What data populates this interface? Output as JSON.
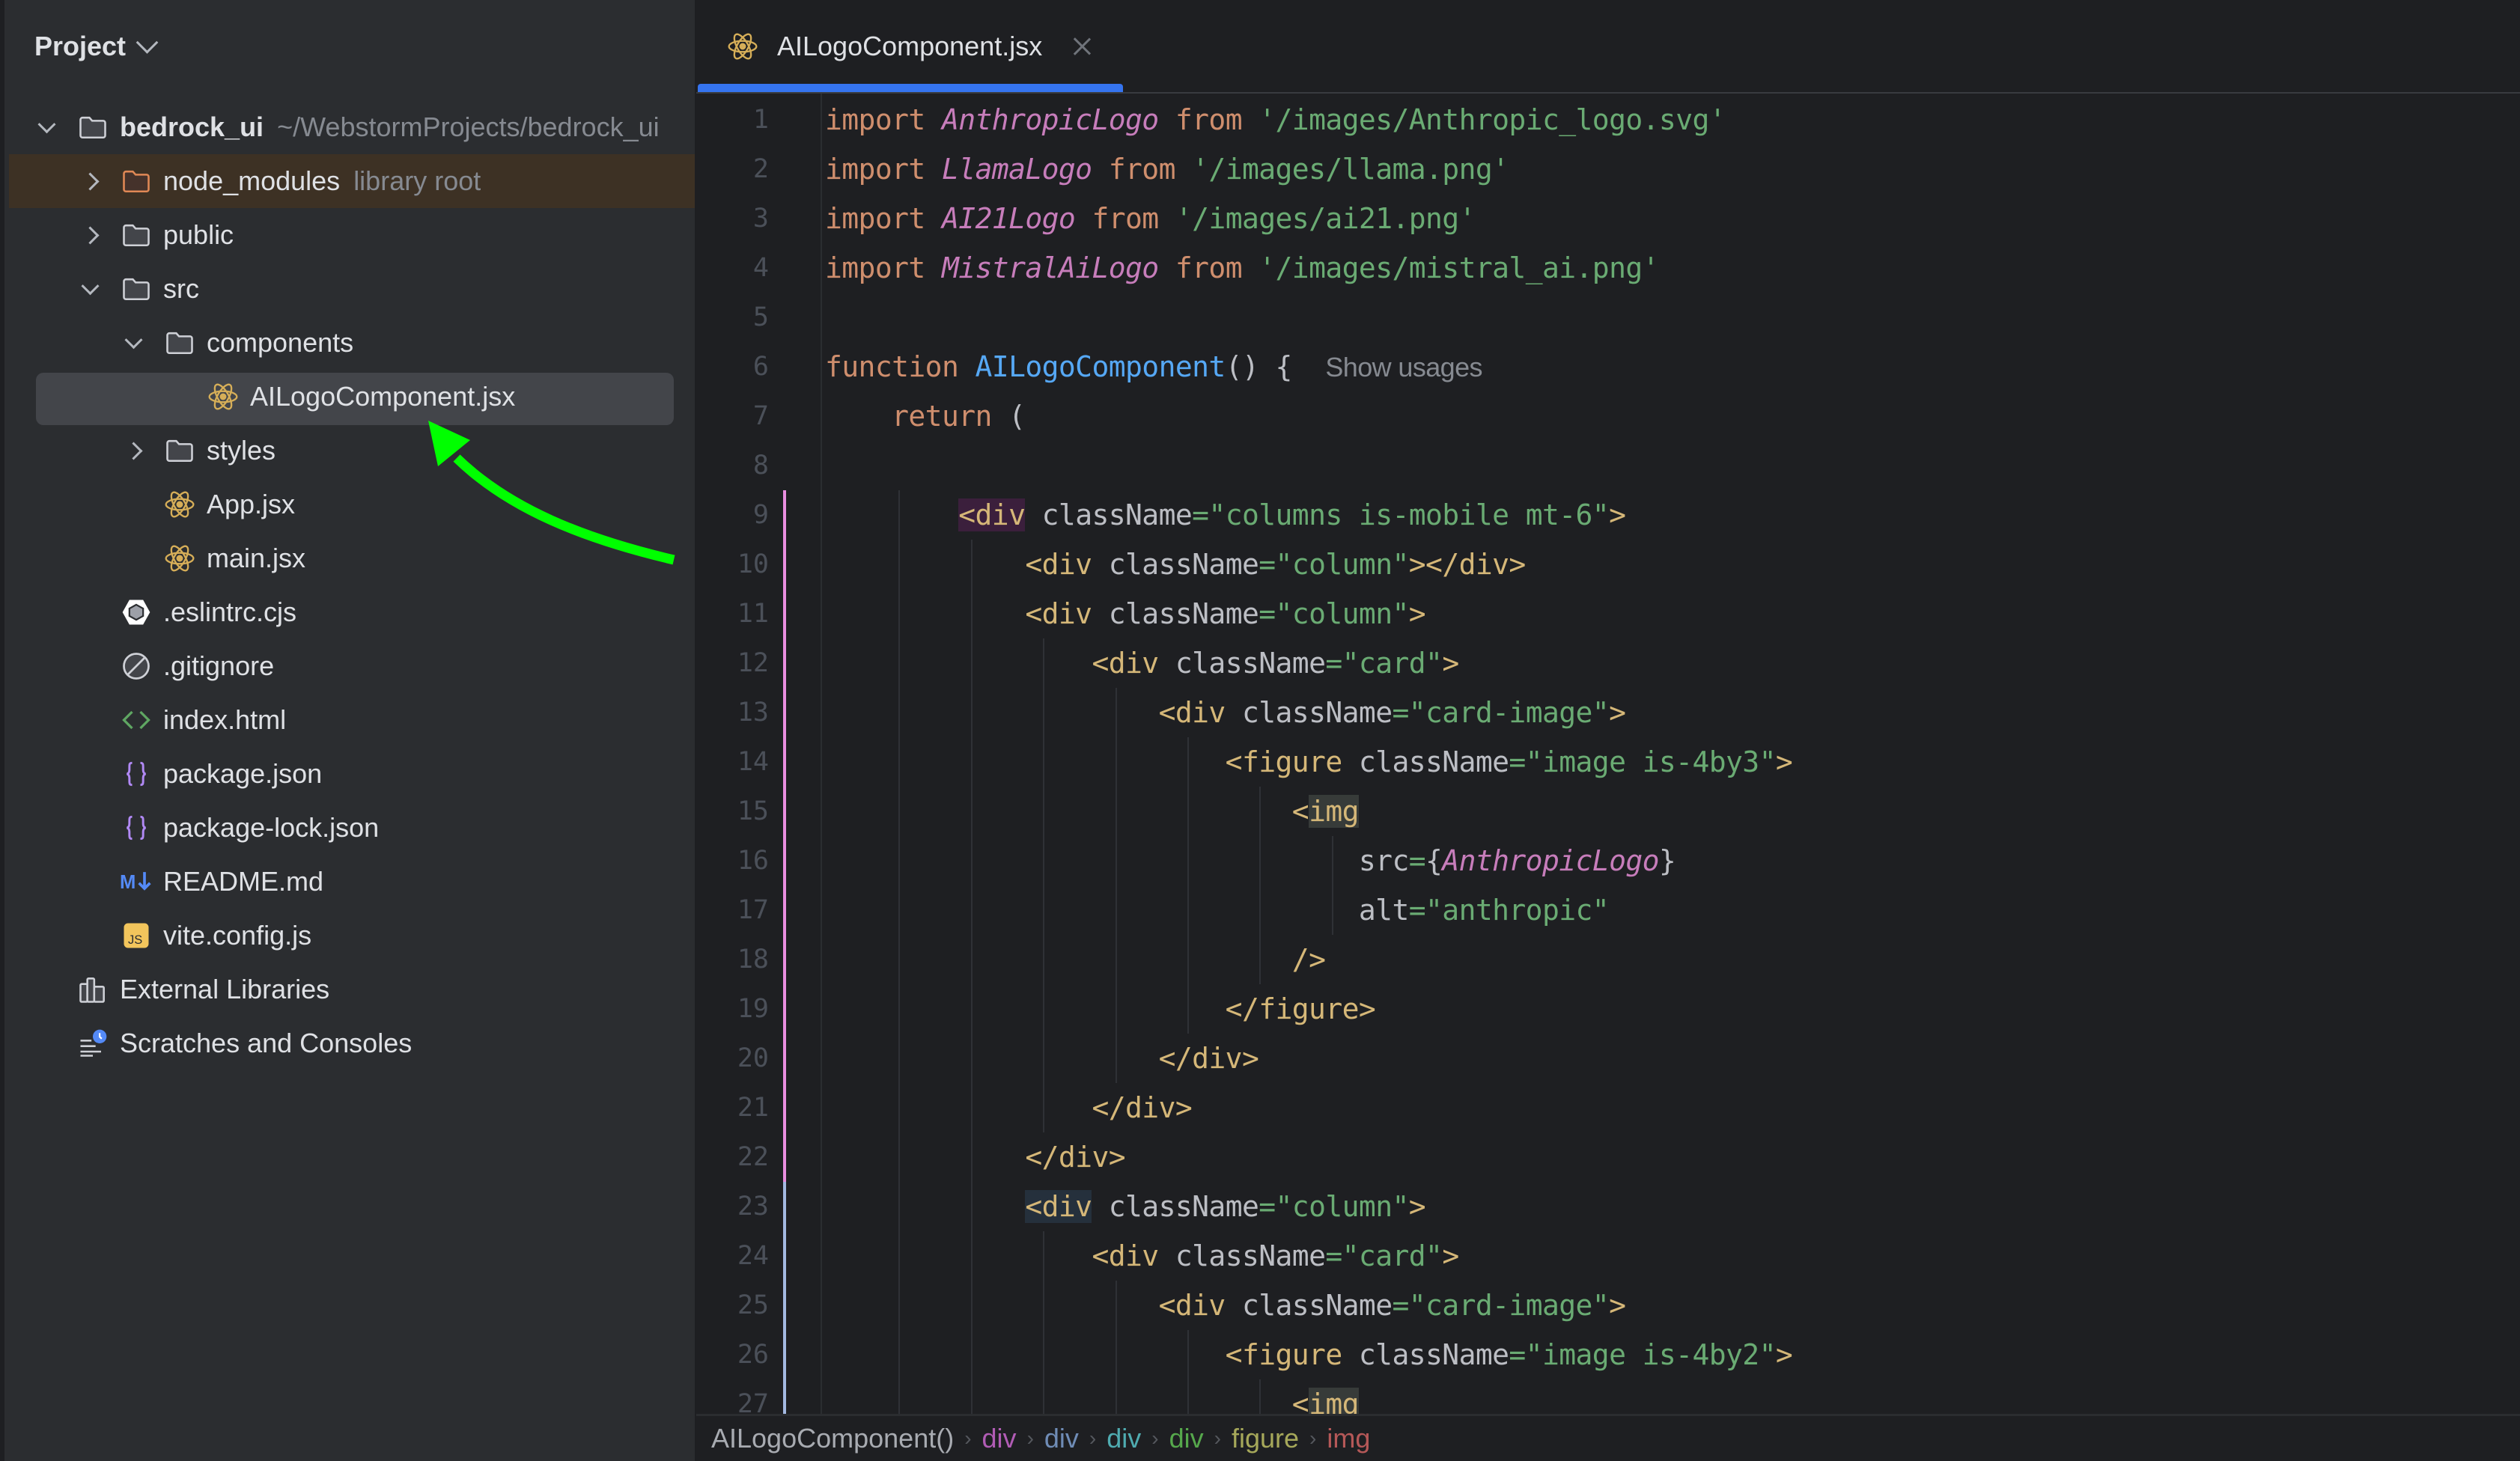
{
  "sidebar": {
    "title": "Project",
    "tree": [
      {
        "label": "bedrock_ui",
        "hint": "~/WebstormProjects/bedrock_ui",
        "icon": "folder-icon",
        "depth": 0,
        "expander": "down",
        "bold": true
      },
      {
        "label": "node_modules",
        "hint": "library root",
        "icon": "folder-library-icon",
        "depth": 1,
        "expander": "right",
        "highlight": "library"
      },
      {
        "label": "public",
        "icon": "folder-icon",
        "depth": 1,
        "expander": "right"
      },
      {
        "label": "src",
        "icon": "folder-icon",
        "depth": 1,
        "expander": "down"
      },
      {
        "label": "components",
        "icon": "folder-icon",
        "depth": 2,
        "expander": "down"
      },
      {
        "label": "AILogoComponent.jsx",
        "icon": "react-icon",
        "depth": 3,
        "expander": "none",
        "selected": true
      },
      {
        "label": "styles",
        "icon": "folder-icon",
        "depth": 2,
        "expander": "right"
      },
      {
        "label": "App.jsx",
        "icon": "react-icon",
        "depth": 2,
        "expander": "none"
      },
      {
        "label": "main.jsx",
        "icon": "react-icon",
        "depth": 2,
        "expander": "none"
      },
      {
        "label": ".eslintrc.cjs",
        "icon": "eslint-icon",
        "depth": 1,
        "expander": "none"
      },
      {
        "label": ".gitignore",
        "icon": "ignore-icon",
        "depth": 1,
        "expander": "none"
      },
      {
        "label": "index.html",
        "icon": "html-icon",
        "depth": 1,
        "expander": "none"
      },
      {
        "label": "package.json",
        "icon": "json-icon",
        "depth": 1,
        "expander": "none"
      },
      {
        "label": "package-lock.json",
        "icon": "json-icon",
        "depth": 1,
        "expander": "none"
      },
      {
        "label": "README.md",
        "icon": "markdown-icon",
        "depth": 1,
        "expander": "none"
      },
      {
        "label": "vite.config.js",
        "icon": "javascript-icon",
        "depth": 1,
        "expander": "none"
      },
      {
        "label": "External Libraries",
        "icon": "external-libraries-icon",
        "depth": 0,
        "expander": "none"
      },
      {
        "label": "Scratches and Consoles",
        "icon": "scratches-icon",
        "depth": 0,
        "expander": "none"
      }
    ]
  },
  "editor": {
    "tab": {
      "label": "AILogoComponent.jsx",
      "icon": "react-icon",
      "active": true
    },
    "hint_show_usages": "Show usages",
    "lines": [
      [
        [
          "kw",
          "import "
        ],
        [
          "imp",
          "AnthropicLogo"
        ],
        [
          "kw",
          " from "
        ],
        [
          "str",
          "'/images/Anthropic_logo.svg'"
        ]
      ],
      [
        [
          "kw",
          "import "
        ],
        [
          "imp",
          "LlamaLogo"
        ],
        [
          "kw",
          " from "
        ],
        [
          "str",
          "'/images/llama.png'"
        ]
      ],
      [
        [
          "kw",
          "import "
        ],
        [
          "imp",
          "AI21Logo"
        ],
        [
          "kw",
          " from "
        ],
        [
          "str",
          "'/images/ai21.png'"
        ]
      ],
      [
        [
          "kw",
          "import "
        ],
        [
          "imp",
          "MistralAiLogo"
        ],
        [
          "kw",
          " from "
        ],
        [
          "str",
          "'/images/mistral_ai.png'"
        ]
      ],
      [],
      [
        [
          "kw",
          "function "
        ],
        [
          "fn",
          "AILogoComponent"
        ],
        [
          "attr",
          "() {  "
        ],
        [
          "hintc",
          "Show usages"
        ]
      ],
      [
        [
          "attr",
          "    "
        ],
        [
          "kw",
          "return "
        ],
        [
          "attr",
          "("
        ]
      ],
      [],
      [
        [
          "attr",
          "        "
        ],
        [
          "tag hl-tag",
          "<div"
        ],
        [
          "attr",
          " className"
        ],
        [
          "str",
          "=\"columns is-mobile mt-6\""
        ],
        [
          "tag",
          ">"
        ]
      ],
      [
        [
          "attr",
          "            "
        ],
        [
          "tag",
          "<div"
        ],
        [
          "attr",
          " className"
        ],
        [
          "str",
          "=\"column\""
        ],
        [
          "tag",
          "></div>"
        ]
      ],
      [
        [
          "attr",
          "            "
        ],
        [
          "tag",
          "<div"
        ],
        [
          "attr",
          " className"
        ],
        [
          "str",
          "=\"column\""
        ],
        [
          "tag",
          ">"
        ]
      ],
      [
        [
          "attr",
          "                "
        ],
        [
          "tag",
          "<div"
        ],
        [
          "attr",
          " className"
        ],
        [
          "str",
          "=\"card\""
        ],
        [
          "tag",
          ">"
        ]
      ],
      [
        [
          "attr",
          "                    "
        ],
        [
          "tag",
          "<div"
        ],
        [
          "attr",
          " className"
        ],
        [
          "str",
          "=\"card-image\""
        ],
        [
          "tag",
          ">"
        ]
      ],
      [
        [
          "attr",
          "                        "
        ],
        [
          "tag",
          "<figure"
        ],
        [
          "attr",
          " className"
        ],
        [
          "str",
          "=\"image is-4by3\""
        ],
        [
          "tag",
          ">"
        ]
      ],
      [
        [
          "attr",
          "                            "
        ],
        [
          "tag",
          "<"
        ],
        [
          "tag hl-img",
          "img"
        ]
      ],
      [
        [
          "attr",
          "                                src"
        ],
        [
          "str",
          "="
        ],
        [
          "attr",
          "{"
        ],
        [
          "imp",
          "AnthropicLogo"
        ],
        [
          "attr",
          "}"
        ]
      ],
      [
        [
          "attr",
          "                                alt"
        ],
        [
          "str",
          "=\"anthropic\""
        ]
      ],
      [
        [
          "attr",
          "                            "
        ],
        [
          "tag",
          "/>"
        ]
      ],
      [
        [
          "attr",
          "                        "
        ],
        [
          "tag",
          "</figure>"
        ]
      ],
      [
        [
          "attr",
          "                    "
        ],
        [
          "tag",
          "</div>"
        ]
      ],
      [
        [
          "attr",
          "                "
        ],
        [
          "tag",
          "</div>"
        ]
      ],
      [
        [
          "attr",
          "            "
        ],
        [
          "tag",
          "</div>"
        ]
      ],
      [
        [
          "attr",
          "            "
        ],
        [
          "tag hl-tag2",
          "<div"
        ],
        [
          "attr",
          " className"
        ],
        [
          "str",
          "=\"column\""
        ],
        [
          "tag",
          ">"
        ]
      ],
      [
        [
          "attr",
          "                "
        ],
        [
          "tag",
          "<div"
        ],
        [
          "attr",
          " className"
        ],
        [
          "str",
          "=\"card\""
        ],
        [
          "tag",
          ">"
        ]
      ],
      [
        [
          "attr",
          "                    "
        ],
        [
          "tag",
          "<div"
        ],
        [
          "attr",
          " className"
        ],
        [
          "str",
          "=\"card-image\""
        ],
        [
          "tag",
          ">"
        ]
      ],
      [
        [
          "attr",
          "                        "
        ],
        [
          "tag",
          "<figure"
        ],
        [
          "attr",
          " className"
        ],
        [
          "str",
          "=\"image is-4by2\""
        ],
        [
          "tag",
          ">"
        ]
      ],
      [
        [
          "attr",
          "                            "
        ],
        [
          "tag",
          "<"
        ],
        [
          "tag hl-img",
          "img"
        ]
      ]
    ]
  },
  "breadcrumbs": [
    {
      "label": "AILogoComponent()",
      "color": "#a8abb1"
    },
    {
      "label": "div",
      "color": "#b15cb5"
    },
    {
      "label": "div",
      "color": "#6f8cb6"
    },
    {
      "label": "div",
      "color": "#4fabb0"
    },
    {
      "label": "div",
      "color": "#56a84c"
    },
    {
      "label": "figure",
      "color": "#a6a85a"
    },
    {
      "label": "img",
      "color": "#b55858"
    }
  ],
  "annotation": {
    "type": "arrow",
    "color": "#00ff00",
    "points_to": "AILogoComponent.jsx"
  },
  "colors": {
    "accent": "#3574f0",
    "change_marker_modified": "#e98ee0",
    "change_marker_new": "#a3b9e1"
  }
}
